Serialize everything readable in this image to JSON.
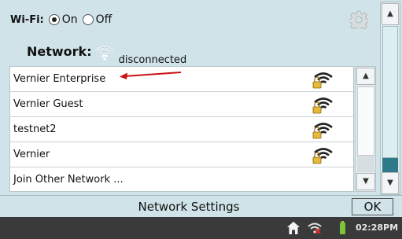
{
  "wifi": {
    "label": "Wi-Fi:",
    "on_label": "On",
    "off_label": "Off",
    "selected": "On"
  },
  "network": {
    "label": "Network:",
    "status": "disconnected"
  },
  "networks": [
    {
      "name": "Vernier Enterprise",
      "locked": true
    },
    {
      "name": "Vernier Guest",
      "locked": true
    },
    {
      "name": "testnet2",
      "locked": true
    },
    {
      "name": "Vernier",
      "locked": true
    },
    {
      "name": "Join Other Network ...",
      "locked": false
    }
  ],
  "footer": {
    "title": "Network Settings",
    "ok_label": "OK"
  },
  "statusbar": {
    "time": "02:28PM"
  },
  "colors": {
    "background": "#cfe3e8",
    "statusbar": "#3a3a3a",
    "accent": "#2f7a8a",
    "arrow": "#cc1111"
  },
  "icons": [
    "gear-icon",
    "wifi-icon",
    "lock-icon",
    "home-icon",
    "battery-icon"
  ]
}
